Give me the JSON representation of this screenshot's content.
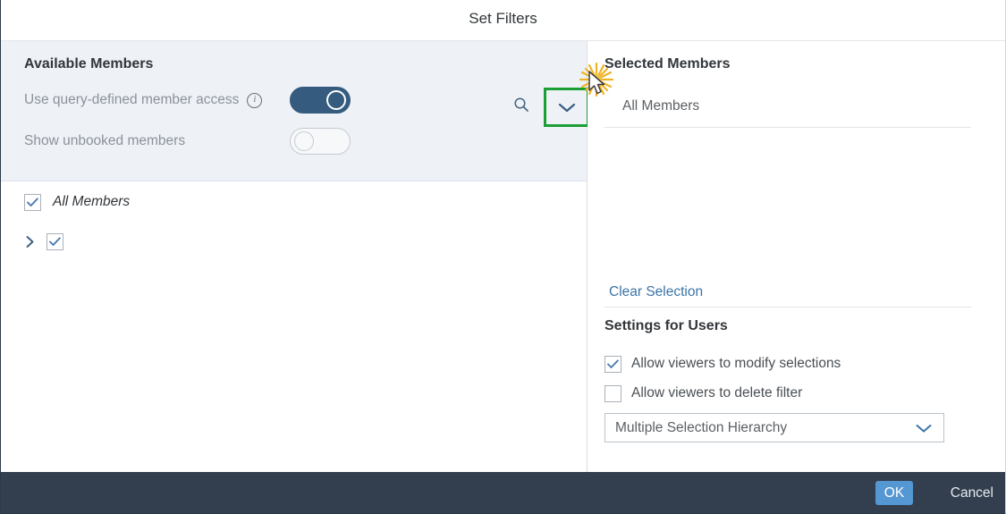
{
  "dialog": {
    "title": "Set Filters"
  },
  "available": {
    "heading": "Available Members",
    "search_icon": "search-icon",
    "collapse_icon": "chevron-down-icon",
    "toggles": [
      {
        "label": "Use query-defined member access",
        "info_icon": "info-icon",
        "state": "on"
      },
      {
        "label": "Show unbooked members",
        "state": "off"
      }
    ],
    "tree": [
      {
        "label": "All Members",
        "checked": true,
        "expandable": false,
        "italic": true
      },
      {
        "label": "",
        "checked": true,
        "expandable": true,
        "expand_icon": "chevron-right-icon",
        "italic": false
      }
    ]
  },
  "selected": {
    "heading": "Selected Members",
    "items": [
      "All Members"
    ],
    "clear_label": "Clear Selection"
  },
  "settings": {
    "heading": "Settings for Users",
    "checkboxes": [
      {
        "label": "Allow viewers to modify selections",
        "checked": true
      },
      {
        "label": "Allow viewers to delete filter",
        "checked": false
      }
    ],
    "selection_mode": {
      "value": "Multiple Selection Hierarchy",
      "arrow_icon": "chevron-down-icon"
    }
  },
  "footer": {
    "ok_label": "OK",
    "cancel_label": "Cancel"
  },
  "colors": {
    "accent_blue": "#355b7f",
    "link_blue": "#3a74a8",
    "highlight_green": "#1a9e35",
    "footer_dark": "#333f4e",
    "ok_button": "#5597d2",
    "panel_bg": "#eef2f7",
    "burst_gold": "#f0b323"
  }
}
